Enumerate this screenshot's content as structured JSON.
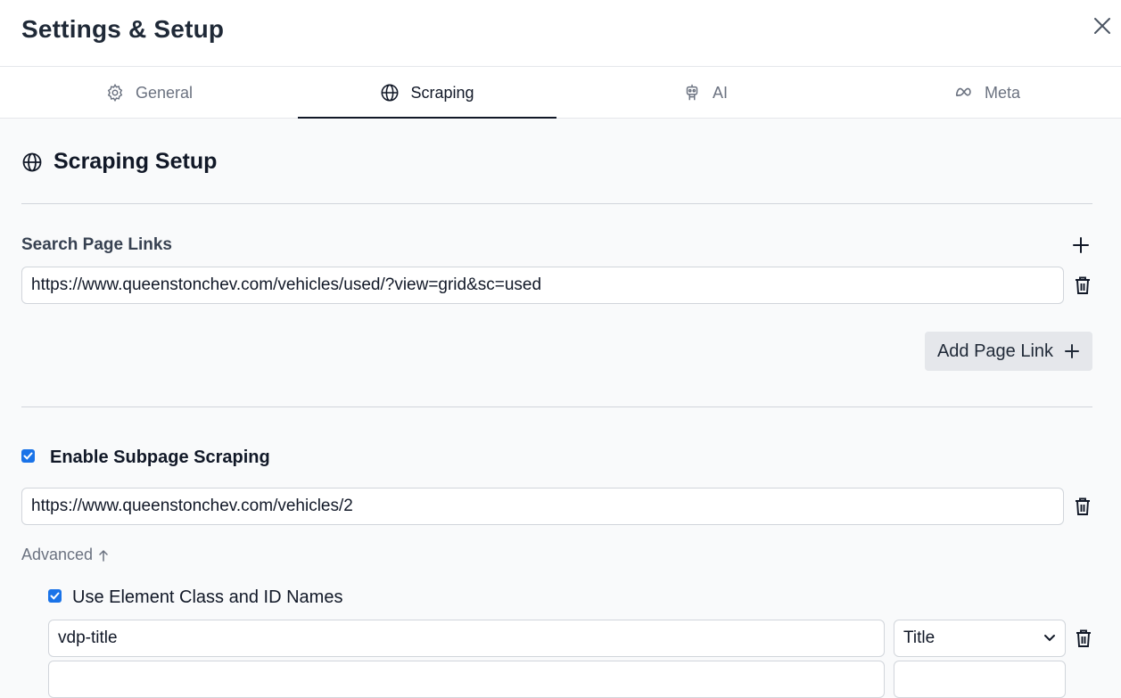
{
  "header": {
    "title": "Settings & Setup"
  },
  "tabs": [
    {
      "label": "General",
      "icon": "gear-icon"
    },
    {
      "label": "Scraping",
      "icon": "globe-icon"
    },
    {
      "label": "AI",
      "icon": "robot-icon"
    },
    {
      "label": "Meta",
      "icon": "meta-icon"
    }
  ],
  "active_tab": "Scraping",
  "section": {
    "title": "Scraping Setup"
  },
  "search_links": {
    "label": "Search Page Links",
    "links": [
      "https://www.queenstonchev.com/vehicles/used/?view=grid&sc=used"
    ],
    "add_button": "Add Page Link"
  },
  "subpage": {
    "enable_label": "Enable Subpage Scraping",
    "enabled": true,
    "url": "https://www.queenstonchev.com/vehicles/2"
  },
  "advanced": {
    "label": "Advanced",
    "use_class_label": "Use Element Class and ID Names",
    "use_class_checked": true,
    "rows": [
      {
        "selector": "vdp-title",
        "field": "Title"
      }
    ]
  },
  "colors": {
    "accent": "#1a73e8",
    "text": "#1f2937",
    "muted": "#6b7280",
    "background": "#f9fafb"
  }
}
